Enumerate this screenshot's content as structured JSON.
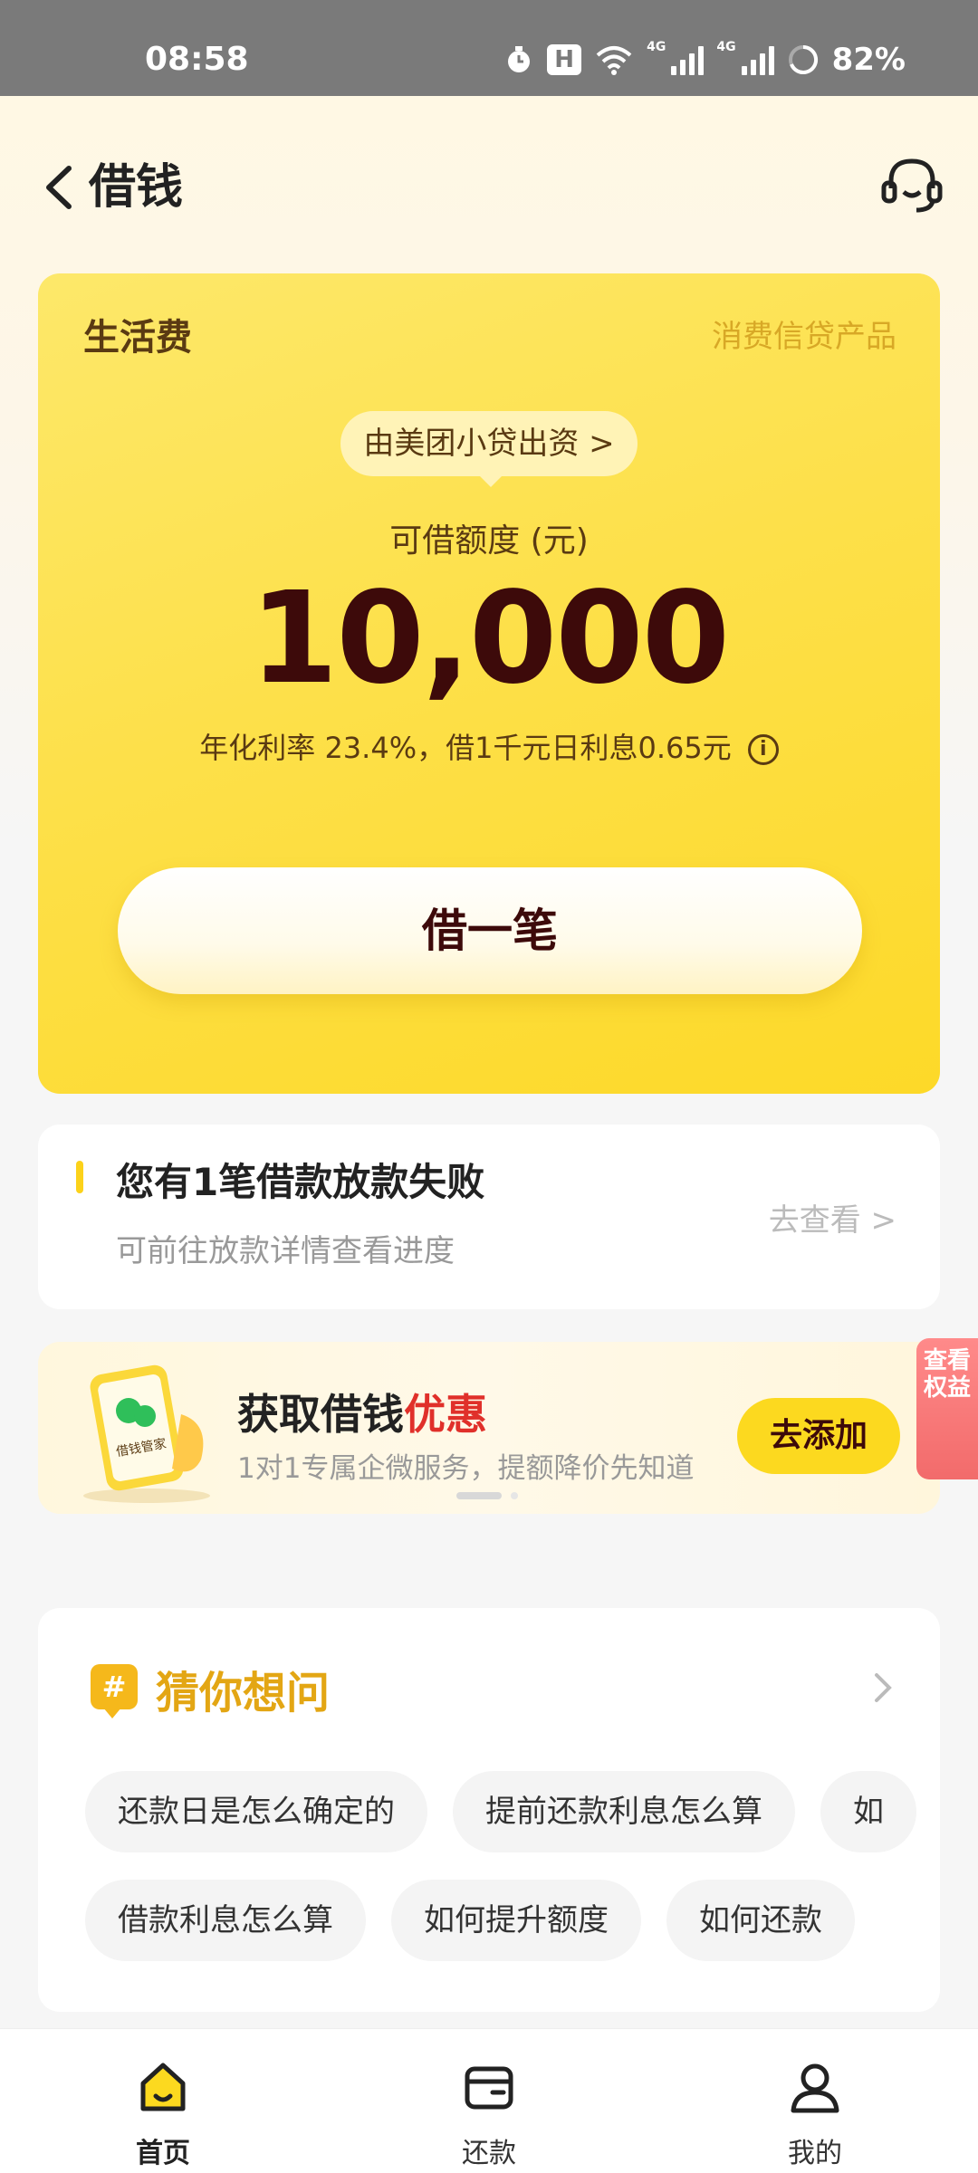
{
  "status_bar": {
    "time": "08:58",
    "battery": "82%",
    "net_label_1": "4G",
    "net_label_2": "4G"
  },
  "nav": {
    "title": "借钱"
  },
  "loan_card": {
    "product_name": "生活费",
    "product_tag": "消费信贷产品",
    "lender": "由美团小贷出资 >",
    "limit_label": "可借额度 (元)",
    "limit_amount": "10,000",
    "rate_text": "年化利率 23.4%，借1千元日利息0.65元",
    "info_glyph": "i",
    "borrow_button": "借一笔"
  },
  "notice": {
    "title": "您有1笔借款放款失败",
    "subtitle": "可前往放款详情查看进度",
    "link": "去查看 >"
  },
  "promo": {
    "title_prefix": "获取借钱",
    "title_highlight": "优惠",
    "subtitle": "1对1专属企微服务，提额降价先知道",
    "button": "去添加",
    "illustration_text": "借钱管家",
    "side_badge": "查看权益"
  },
  "faq": {
    "icon_glyph": "#",
    "title": "猜你想问",
    "row1": [
      "还款日是怎么确定的",
      "提前还款利息怎么算",
      "如"
    ],
    "row2": [
      "借款利息怎么算",
      "如何提升额度",
      "如何还款"
    ]
  },
  "tab_bar": {
    "tabs": [
      {
        "label": "首页",
        "active": true
      },
      {
        "label": "还款",
        "active": false
      },
      {
        "label": "我的",
        "active": false
      }
    ]
  },
  "colors": {
    "accent_yellow": "#fcd91f",
    "amount_color": "#3d0a0a",
    "highlight_red": "#e0302a",
    "faq_title": "#e3a614"
  }
}
